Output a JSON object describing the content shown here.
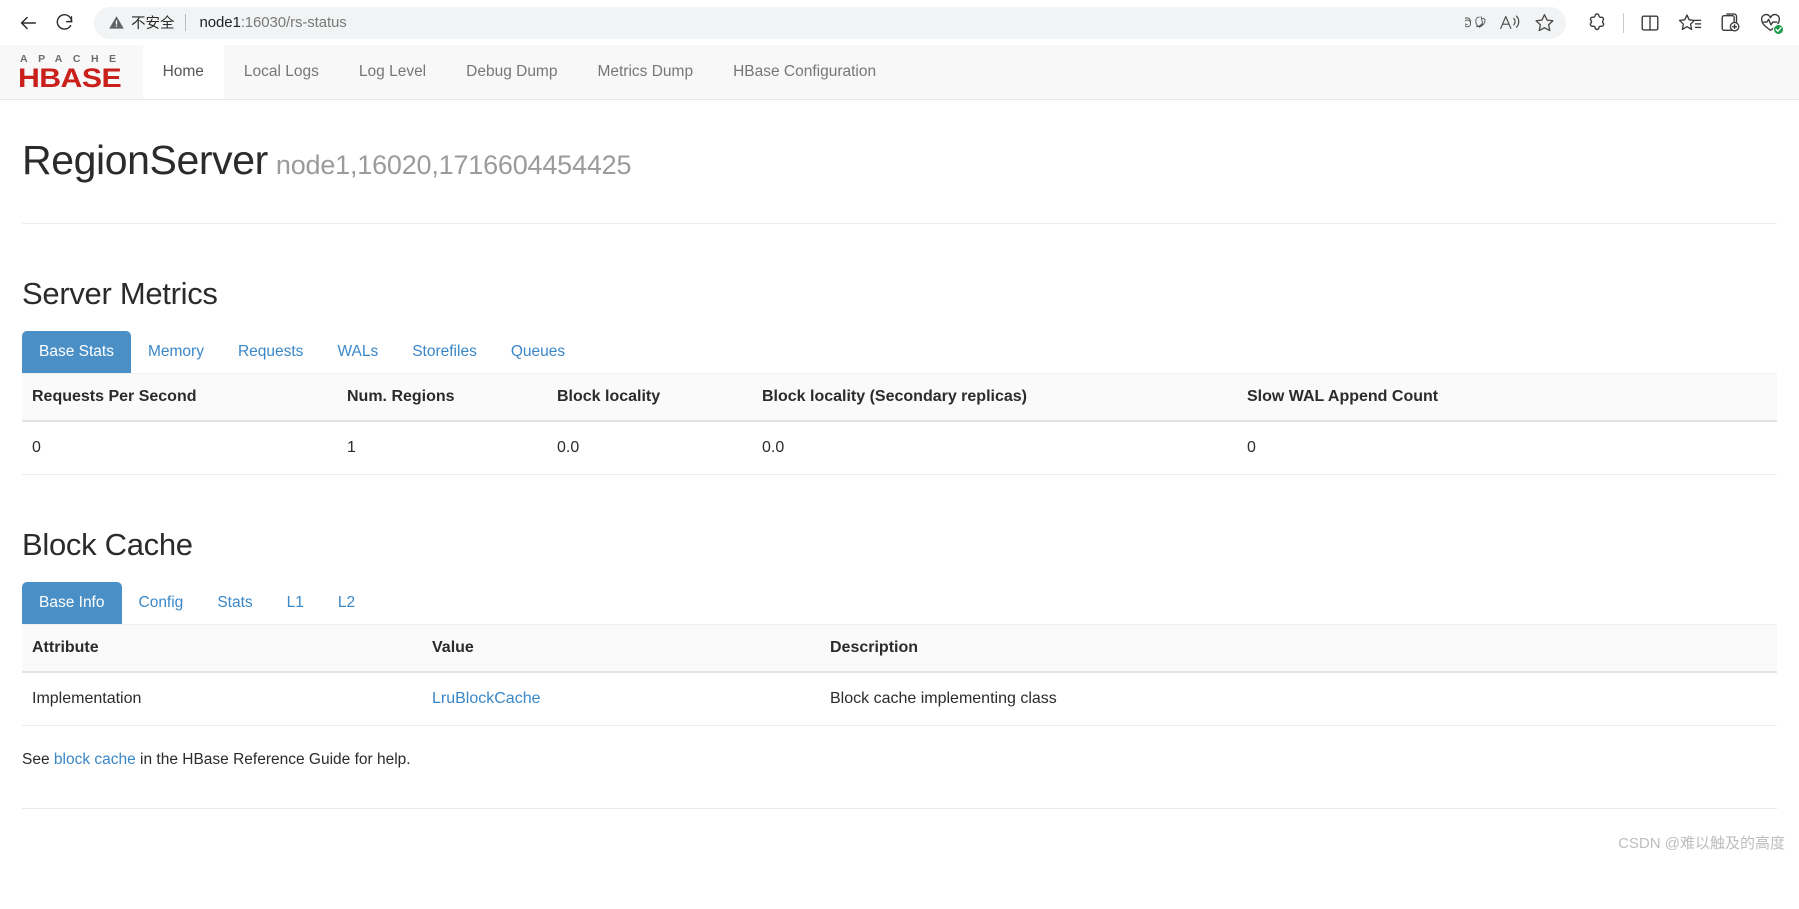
{
  "browser": {
    "back_label": "Back",
    "reload_label": "Refresh",
    "security_text": "不安全",
    "url_host": "node1",
    "url_rest": ":16030/rs-status",
    "pill_icons": [
      "translate-icon",
      "read-aloud-icon",
      "favorite-star-icon"
    ],
    "toolbar_icons": [
      "extensions-icon",
      "split-screen-icon",
      "collections-icon",
      "add-to-collections-icon",
      "browser-essentials-icon"
    ]
  },
  "brand": {
    "apache": "APACHE",
    "hbase": "HBASE",
    "logo_gray": "#6e6e6e",
    "logo_red": "#c9201b"
  },
  "nav": {
    "items": [
      {
        "label": "Home",
        "active": true
      },
      {
        "label": "Local Logs",
        "active": false
      },
      {
        "label": "Log Level",
        "active": false
      },
      {
        "label": "Debug Dump",
        "active": false
      },
      {
        "label": "Metrics Dump",
        "active": false
      },
      {
        "label": "HBase Configuration",
        "active": false
      }
    ]
  },
  "header": {
    "title": "RegionServer",
    "server_id": "node1,16020,1716604454425"
  },
  "server_metrics": {
    "title": "Server Metrics",
    "tabs": [
      {
        "label": "Base Stats",
        "active": true
      },
      {
        "label": "Memory",
        "active": false
      },
      {
        "label": "Requests",
        "active": false
      },
      {
        "label": "WALs",
        "active": false
      },
      {
        "label": "Storefiles",
        "active": false
      },
      {
        "label": "Queues",
        "active": false
      }
    ],
    "columns": [
      "Requests Per Second",
      "Num. Regions",
      "Block locality",
      "Block locality (Secondary replicas)",
      "Slow WAL Append Count"
    ],
    "rows": [
      [
        "0",
        "1",
        "0.0",
        "0.0",
        "0"
      ]
    ]
  },
  "block_cache": {
    "title": "Block Cache",
    "tabs": [
      {
        "label": "Base Info",
        "active": true
      },
      {
        "label": "Config",
        "active": false
      },
      {
        "label": "Stats",
        "active": false
      },
      {
        "label": "L1",
        "active": false
      },
      {
        "label": "L2",
        "active": false
      }
    ],
    "columns": [
      "Attribute",
      "Value",
      "Description"
    ],
    "rows": [
      {
        "attribute": "Implementation",
        "value": "LruBlockCache",
        "value_is_link": true,
        "description": "Block cache implementing class"
      }
    ],
    "help_prefix": "See ",
    "help_link": "block cache",
    "help_suffix": " in the HBase Reference Guide for help."
  },
  "watermark": "CSDN @难以触及的高度",
  "colors": {
    "tab_active_bg": "#4a90c7",
    "link": "#3a87c8",
    "nav_bg": "#f8f8f8"
  }
}
